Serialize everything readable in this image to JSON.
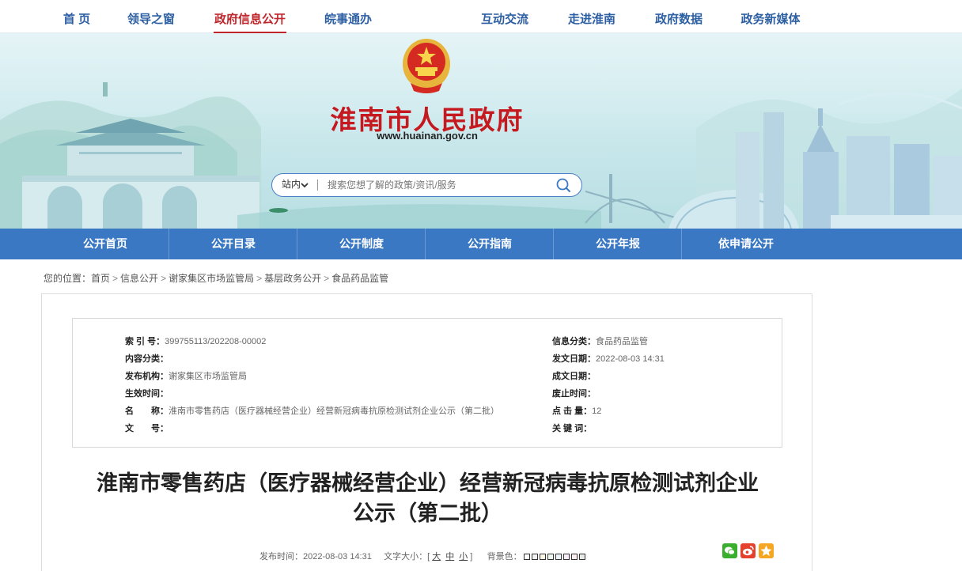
{
  "top_nav": {
    "items": [
      {
        "label": "首 页"
      },
      {
        "label": "领导之窗"
      },
      {
        "label": "政府信息公开",
        "active": true
      },
      {
        "label": "皖事通办"
      },
      {
        "label": "互动交流"
      },
      {
        "label": "走进淮南"
      },
      {
        "label": "政府数据"
      },
      {
        "label": "政务新媒体"
      }
    ]
  },
  "banner": {
    "site_name": "淮南市人民政府",
    "site_url": "www.huainan.gov.cn",
    "emblem_icon": "national-emblem-icon",
    "search": {
      "scope_label": "站内",
      "placeholder": "搜索您想了解的政策/资讯/服务"
    }
  },
  "sub_nav": {
    "items": [
      {
        "label": "公开首页"
      },
      {
        "label": "公开目录"
      },
      {
        "label": "公开制度"
      },
      {
        "label": "公开指南"
      },
      {
        "label": "公开年报"
      },
      {
        "label": "依申请公开"
      }
    ]
  },
  "breadcrumb": {
    "prefix": "您的位置：",
    "items": [
      "首页",
      "信息公开",
      "谢家集区市场监管局",
      "基层政务公开",
      "食品药品监管"
    ]
  },
  "meta": {
    "index_no": {
      "label": "索 引 号：",
      "value": "399755113/202208-00002"
    },
    "content_category": {
      "label": "内容分类：",
      "value": ""
    },
    "publisher": {
      "label": "发布机构：",
      "value": "谢家集区市场监管局"
    },
    "effective_date": {
      "label": "生效时间：",
      "value": ""
    },
    "name": {
      "label": "名　　称：",
      "value": "淮南市零售药店（医疗器械经营企业）经营新冠病毒抗原检测试剂企业公示（第二批）"
    },
    "doc_no": {
      "label": "文　　号：",
      "value": ""
    },
    "info_category": {
      "label": "信息分类：",
      "value": "食品药品监管"
    },
    "issue_date": {
      "label": "发文日期：",
      "value": "2022-08-03 14:31"
    },
    "creation_date": {
      "label": "成文日期：",
      "value": ""
    },
    "expiry_date": {
      "label": "废止时间：",
      "value": ""
    },
    "views": {
      "label": "点 击 量：",
      "value": "12"
    },
    "keywords": {
      "label": "关 键 词：",
      "value": ""
    }
  },
  "article": {
    "title_line1": "淮南市零售药店（医疗器械经营企业）经营新冠病毒抗原检测试剂企业",
    "title_line2": "公示（第二批）",
    "publish_label": "发布时间：",
    "publish_time": "2022-08-03 14:31",
    "font_size_label": "文字大小：[",
    "font_sizes": [
      "大",
      "中",
      "小"
    ],
    "font_size_close": "]",
    "bg_color_label": "背景色：",
    "bg_colors": [
      "#ffffff",
      "#f2f2f2",
      "#fff8e8",
      "#f0f7ee",
      "#eef4fb",
      "#f7eef7",
      "#fdf1ee",
      "#e8e8e8"
    ]
  },
  "share": {
    "wechat": {
      "icon": "wechat-icon",
      "color": "#3aaf2f"
    },
    "weibo": {
      "icon": "weibo-icon",
      "color": "#e6412c"
    },
    "qzone": {
      "icon": "qzone-icon",
      "color": "#f5a623"
    }
  },
  "colors": {
    "brand_blue": "#3a78c3",
    "nav_text": "#2d5fa3",
    "active_red": "#c0272d",
    "site_name_red": "#c5191f"
  }
}
